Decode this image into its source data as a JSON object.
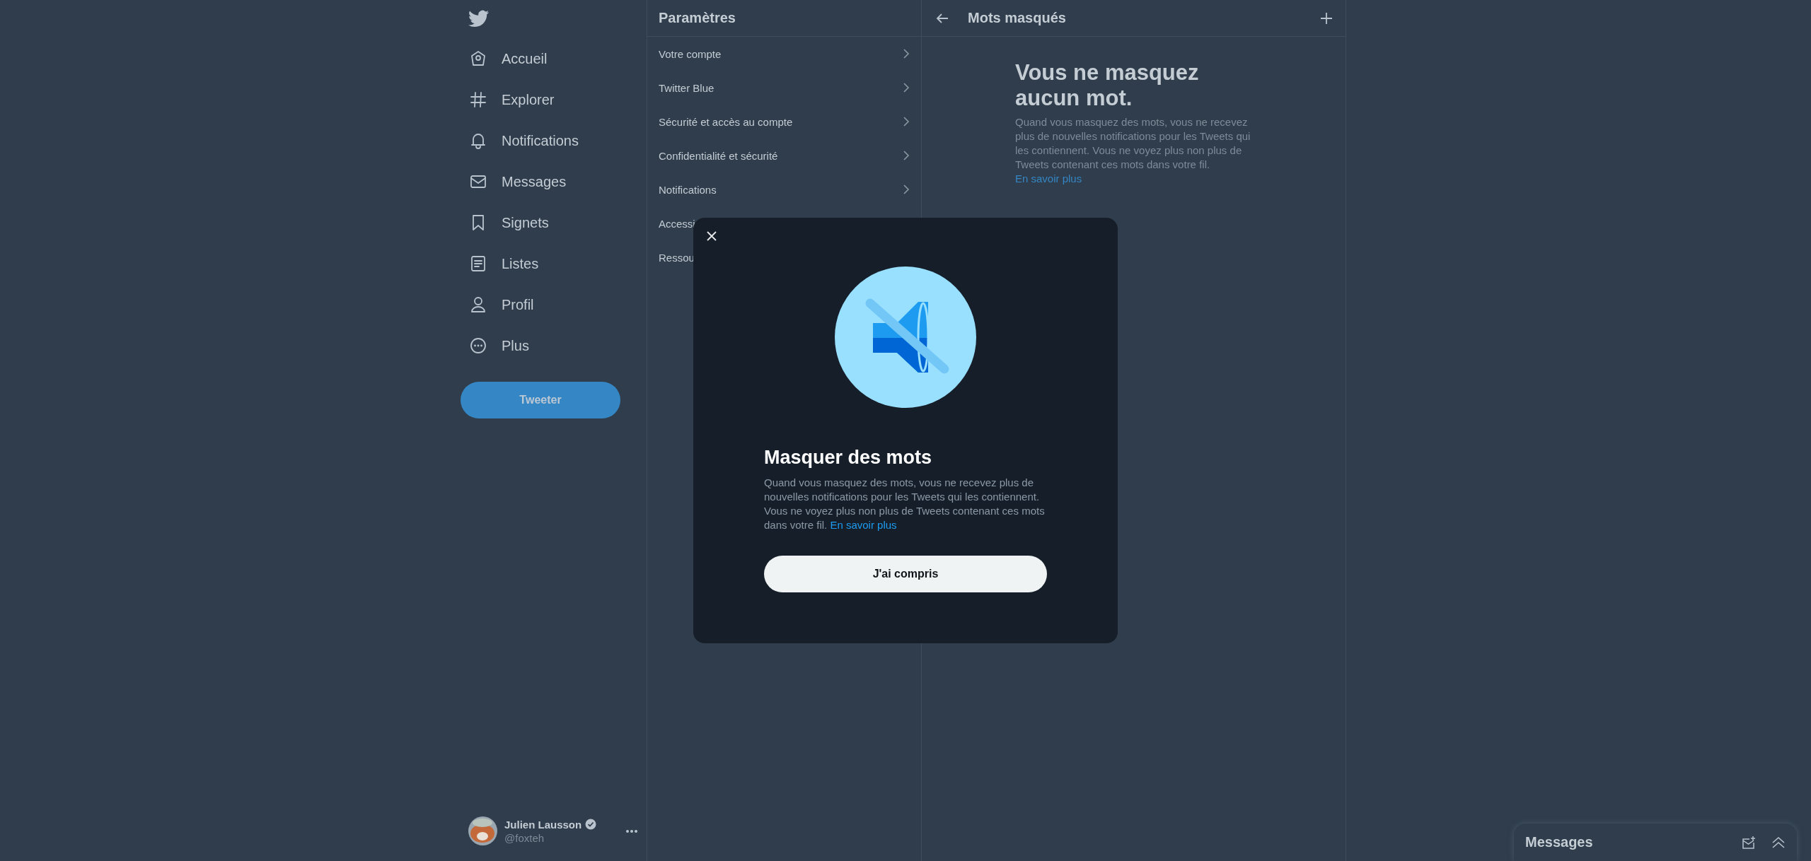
{
  "nav": {
    "items": [
      {
        "label": "Accueil"
      },
      {
        "label": "Explorer"
      },
      {
        "label": "Notifications"
      },
      {
        "label": "Messages"
      },
      {
        "label": "Signets"
      },
      {
        "label": "Listes"
      },
      {
        "label": "Profil"
      },
      {
        "label": "Plus"
      }
    ],
    "tweet_button": "Tweeter"
  },
  "account": {
    "name": "Julien Lausson",
    "verified": true,
    "handle": "@foxteh"
  },
  "settings": {
    "title": "Paramètres",
    "items": [
      {
        "label": "Votre compte",
        "chevron": true
      },
      {
        "label": "Twitter Blue",
        "chevron": true
      },
      {
        "label": "Sécurité et accès au compte",
        "chevron": true
      },
      {
        "label": "Confidentialité et sécurité",
        "chevron": true
      },
      {
        "label": "Notifications",
        "chevron": true
      },
      {
        "label": "Accessi",
        "chevron": false
      },
      {
        "label": "Ressou",
        "chevron": false
      }
    ]
  },
  "panel": {
    "title": "Mots masqués",
    "empty_title": "Vous ne masquez aucun mot.",
    "empty_text": "Quand vous masquez des mots, vous ne recevez plus de nouvelles notifications pour les Tweets qui les contiennent. Vous ne voyez plus non plus de Tweets contenant ces mots dans votre fil.",
    "empty_link": "En savoir plus"
  },
  "dialog": {
    "title": "Masquer des mots",
    "text": "Quand vous masquez des mots, vous ne recevez plus de nouvelles notifications pour les Tweets qui les contiennent. Vous ne voyez plus non plus de Tweets contenant ces mots dans votre fil.",
    "link": "En savoir plus",
    "button": "J'ai compris"
  },
  "messages_drawer": {
    "title": "Messages"
  }
}
